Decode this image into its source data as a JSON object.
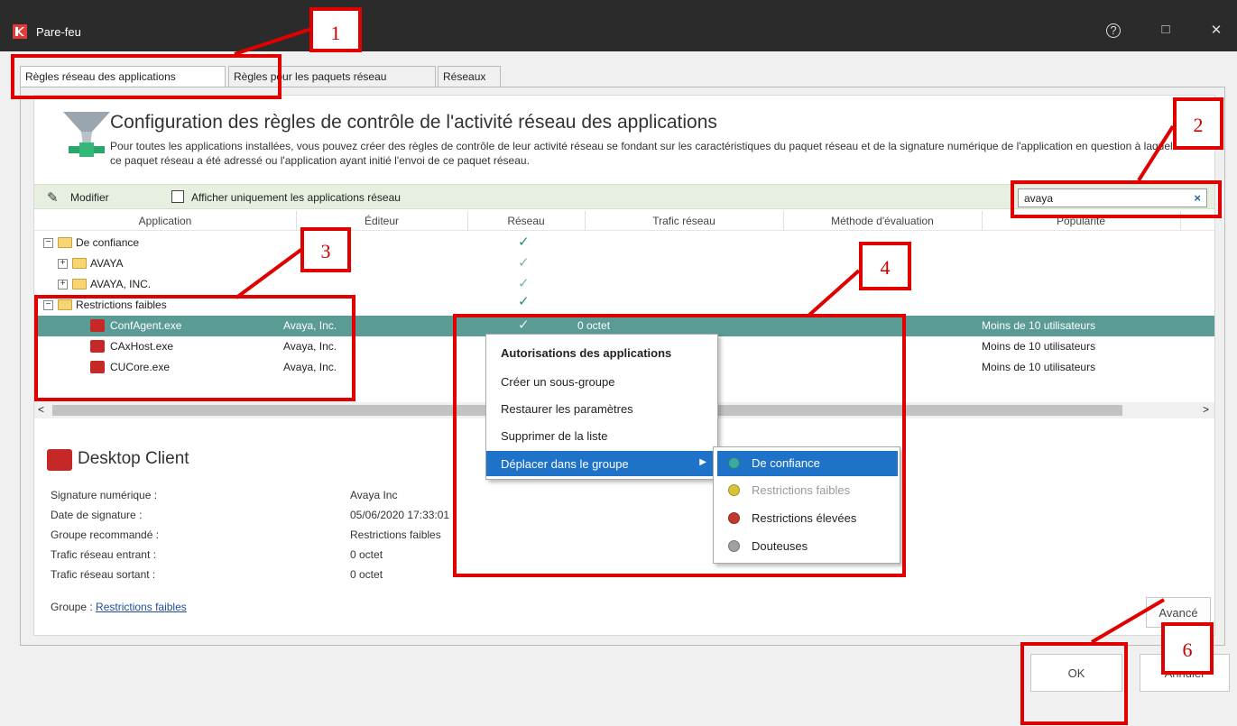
{
  "window": {
    "title": "Pare-feu",
    "help_label": "?",
    "maximize_label": "□",
    "close_label": "✕"
  },
  "tabs": [
    {
      "label": "Règles réseau des applications",
      "active": true
    },
    {
      "label": "Règles pour les paquets réseau",
      "active": false
    },
    {
      "label": "Réseaux",
      "active": false
    }
  ],
  "header": {
    "title": "Configuration des règles de contrôle de l'activité réseau des applications",
    "description": "Pour toutes les applications installées, vous pouvez créer des règles de contrôle de leur activité réseau se fondant sur les caractéristiques du paquet réseau et de la signature numérique de l'application en question à laquelle ce paquet réseau a été adressé ou l'application ayant initié l'envoi de ce paquet réseau."
  },
  "toolbar": {
    "edit_label": "Modifier",
    "checkbox_label": "Afficher uniquement les applications réseau",
    "search_value": "avaya",
    "clear_label": "×"
  },
  "columns": [
    "Application",
    "Éditeur",
    "Réseau",
    "Trafic réseau",
    "Méthode d'évaluation",
    "Popularité"
  ],
  "tree": [
    {
      "label": "De confiance",
      "publisher": "",
      "traffic": "",
      "popularity": ""
    },
    {
      "label": "AVAYA",
      "publisher": "",
      "traffic": "",
      "popularity": ""
    },
    {
      "label": "AVAYA, INC.",
      "publisher": "",
      "traffic": "",
      "popularity": ""
    },
    {
      "label": "Restrictions faibles",
      "publisher": "",
      "traffic": "",
      "popularity": ""
    },
    {
      "label": "ConfAgent.exe",
      "publisher": "Avaya, Inc.",
      "traffic": "0 octet",
      "popularity": "Moins de 10 utilisateurs"
    },
    {
      "label": "CAxHost.exe",
      "publisher": "Avaya, Inc.",
      "traffic": "",
      "popularity": "Moins de 10 utilisateurs"
    },
    {
      "label": "CUCore.exe",
      "publisher": "Avaya, Inc.",
      "traffic": "",
      "popularity": "Moins de 10 utilisateurs"
    }
  ],
  "scroll": {
    "left": "<",
    "right": ">"
  },
  "detail": {
    "title": "Desktop Client",
    "rows": [
      {
        "label": "Signature numérique :",
        "value": "Avaya Inc"
      },
      {
        "label": "Date de signature :",
        "value": "05/06/2020 17:33:01"
      },
      {
        "label": "Groupe recommandé :",
        "value": "Restrictions faibles"
      },
      {
        "label": "Trafic réseau entrant :",
        "value": "0 octet"
      },
      {
        "label": "Trafic réseau sortant :",
        "value": "0 octet"
      }
    ],
    "group_label": "Groupe :",
    "group_link": "Restrictions faibles",
    "advanced_label": "Avancé"
  },
  "context_menu": {
    "items": [
      {
        "label": "Autorisations des applications",
        "bold": true
      },
      {
        "label": "Créer un sous-groupe"
      },
      {
        "label": "Restaurer les paramètres"
      },
      {
        "label": "Supprimer de la liste"
      },
      {
        "label": "Déplacer dans le groupe",
        "highlighted": true,
        "submenu": true
      }
    ],
    "submenu": [
      {
        "label": "De confiance",
        "color": "#3aa99f",
        "highlighted": true
      },
      {
        "label": "Restrictions faibles",
        "color": "#d8c23a",
        "disabled": true
      },
      {
        "label": "Restrictions élevées",
        "color": "#c0392b"
      },
      {
        "label": "Douteuses",
        "color": "#a0a0a0"
      }
    ]
  },
  "footer": {
    "ok_label": "OK",
    "cancel_label": "Annuler"
  },
  "annotations": [
    "1",
    "2",
    "3",
    "4",
    "6"
  ],
  "colors": {
    "accent": "#5b9b95",
    "highlight": "#1e73c8",
    "annotation": "#e00000"
  }
}
